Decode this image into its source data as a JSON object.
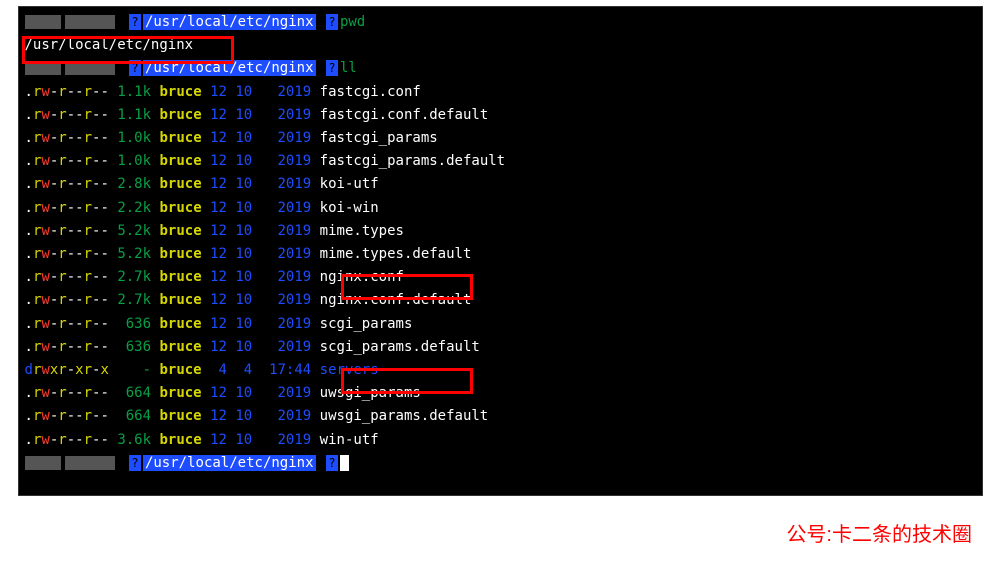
{
  "prompt_path": "/usr/local/etc/nginx",
  "cmd_pwd": "pwd",
  "pwd_output": "/usr/local/etc/nginx",
  "cmd_ll": "ll",
  "user": "bruce",
  "qmark": "?",
  "files": [
    {
      "perm_prefix": ".",
      "perm": "rw-r--r--",
      "size": "1.1",
      "size_suffix": "k",
      "day": "12",
      "month": "10",
      "year": "2019",
      "name": "fastcgi.conf",
      "dir": false
    },
    {
      "perm_prefix": ".",
      "perm": "rw-r--r--",
      "size": "1.1",
      "size_suffix": "k",
      "day": "12",
      "month": "10",
      "year": "2019",
      "name": "fastcgi.conf.default",
      "dir": false
    },
    {
      "perm_prefix": ".",
      "perm": "rw-r--r--",
      "size": "1.0",
      "size_suffix": "k",
      "day": "12",
      "month": "10",
      "year": "2019",
      "name": "fastcgi_params",
      "dir": false
    },
    {
      "perm_prefix": ".",
      "perm": "rw-r--r--",
      "size": "1.0",
      "size_suffix": "k",
      "day": "12",
      "month": "10",
      "year": "2019",
      "name": "fastcgi_params.default",
      "dir": false
    },
    {
      "perm_prefix": ".",
      "perm": "rw-r--r--",
      "size": "2.8",
      "size_suffix": "k",
      "day": "12",
      "month": "10",
      "year": "2019",
      "name": "koi-utf",
      "dir": false
    },
    {
      "perm_prefix": ".",
      "perm": "rw-r--r--",
      "size": "2.2",
      "size_suffix": "k",
      "day": "12",
      "month": "10",
      "year": "2019",
      "name": "koi-win",
      "dir": false
    },
    {
      "perm_prefix": ".",
      "perm": "rw-r--r--",
      "size": "5.2",
      "size_suffix": "k",
      "day": "12",
      "month": "10",
      "year": "2019",
      "name": "mime.types",
      "dir": false
    },
    {
      "perm_prefix": ".",
      "perm": "rw-r--r--",
      "size": "5.2",
      "size_suffix": "k",
      "day": "12",
      "month": "10",
      "year": "2019",
      "name": "mime.types.default",
      "dir": false
    },
    {
      "perm_prefix": ".",
      "perm": "rw-r--r--",
      "size": "2.7",
      "size_suffix": "k",
      "day": "12",
      "month": "10",
      "year": "2019",
      "name": "nginx.conf",
      "dir": false
    },
    {
      "perm_prefix": ".",
      "perm": "rw-r--r--",
      "size": "2.7",
      "size_suffix": "k",
      "day": "12",
      "month": "10",
      "year": "2019",
      "name": "nginx.conf.default",
      "dir": false
    },
    {
      "perm_prefix": ".",
      "perm": "rw-r--r--",
      "size": " 636",
      "size_suffix": "",
      "day": "12",
      "month": "10",
      "year": "2019",
      "name": "scgi_params",
      "dir": false
    },
    {
      "perm_prefix": ".",
      "perm": "rw-r--r--",
      "size": " 636",
      "size_suffix": "",
      "day": "12",
      "month": "10",
      "year": "2019",
      "name": "scgi_params.default",
      "dir": false
    },
    {
      "perm_prefix": "d",
      "perm": "rwxr-xr-x",
      "size": "   -",
      "size_suffix": "",
      "day": " 4",
      "month": " 4",
      "year": "17:44",
      "name": "servers",
      "dir": true
    },
    {
      "perm_prefix": ".",
      "perm": "rw-r--r--",
      "size": " 664",
      "size_suffix": "",
      "day": "12",
      "month": "10",
      "year": "2019",
      "name": "uwsgi_params",
      "dir": false
    },
    {
      "perm_prefix": ".",
      "perm": "rw-r--r--",
      "size": " 664",
      "size_suffix": "",
      "day": "12",
      "month": "10",
      "year": "2019",
      "name": "uwsgi_params.default",
      "dir": false
    },
    {
      "perm_prefix": ".",
      "perm": "rw-r--r--",
      "size": "3.6",
      "size_suffix": "k",
      "day": "12",
      "month": "10",
      "year": "2019",
      "name": "win-utf",
      "dir": false
    }
  ],
  "watermark": "公号:卡二条的技术圈"
}
